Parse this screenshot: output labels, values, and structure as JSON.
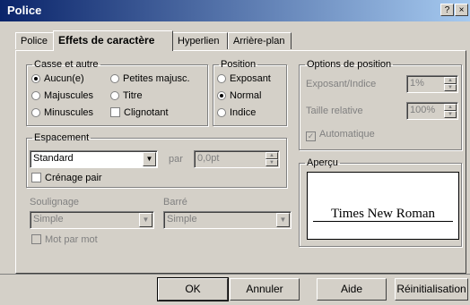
{
  "window": {
    "title": "Police"
  },
  "tabs": [
    {
      "label": "Police"
    },
    {
      "label": "Effets de caractère"
    },
    {
      "label": "Hyperlien"
    },
    {
      "label": "Arrière-plan"
    }
  ],
  "casse": {
    "legend": "Casse et autre",
    "col1": [
      {
        "label": "Aucun(e)",
        "selected": true
      },
      {
        "label": "Majuscules",
        "selected": false
      },
      {
        "label": "Minuscules",
        "selected": false
      }
    ],
    "col2": [
      {
        "label": "Petites majusc.",
        "selected": false
      },
      {
        "label": "Titre",
        "selected": false
      },
      {
        "label": "Clignotant",
        "checked": false
      }
    ]
  },
  "position": {
    "legend": "Position",
    "items": [
      {
        "label": "Exposant",
        "selected": false
      },
      {
        "label": "Normal",
        "selected": true
      },
      {
        "label": "Indice",
        "selected": false
      }
    ]
  },
  "options": {
    "legend": "Options de position",
    "exposant_label": "Exposant/Indice",
    "exposant_value": "1%",
    "taille_label": "Taille relative",
    "taille_value": "100%",
    "auto_label": "Automatique",
    "auto_checked": true
  },
  "espacement": {
    "legend": "Espacement",
    "value": "Standard",
    "par_label": "par",
    "par_value": "0,0pt",
    "crenage_label": "Crénage pair",
    "crenage_checked": false
  },
  "soulignage": {
    "label": "Soulignage",
    "value": "Simple"
  },
  "barre": {
    "label": "Barré",
    "value": "Simple"
  },
  "motparmot": {
    "label": "Mot par mot",
    "checked": false
  },
  "apercu": {
    "legend": "Aperçu",
    "text": "Times New Roman"
  },
  "buttons": {
    "ok": "OK",
    "annuler": "Annuler",
    "aide": "Aide",
    "reinit": "Réinitialisation"
  }
}
